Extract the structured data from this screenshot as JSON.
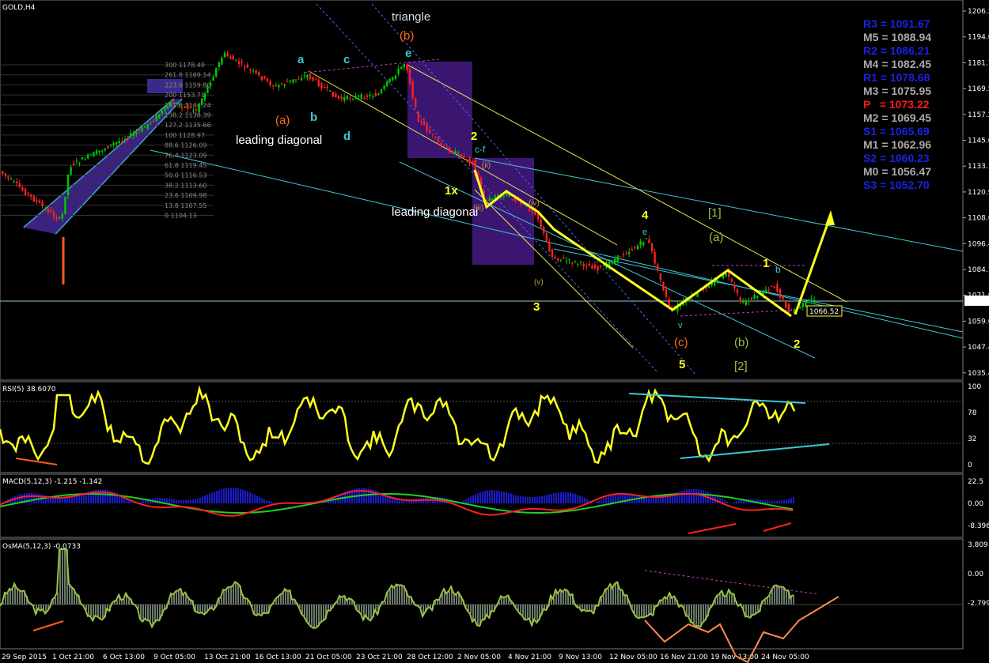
{
  "window": {
    "symbol_label": "GOLD,H4"
  },
  "price_axis": {
    "ticks": [
      "1206.25",
      "1194.00",
      "1181.75",
      "1169.50",
      "1157.25",
      "1145.00",
      "1133.15",
      "1120.90",
      "1108.65",
      "1096.40",
      "1084.15",
      "1071.90",
      "1059.65",
      "1047.40",
      "1035.40"
    ],
    "current_price": "1070.8",
    "marked_price": "1066.52"
  },
  "time_axis": {
    "ticks": [
      "29 Sep 2015",
      "1 Oct 21:00",
      "6 Oct 13:00",
      "9 Oct 05:00",
      "13 Oct 21:00",
      "16 Oct 13:00",
      "21 Oct 05:00",
      "23 Oct 21:00",
      "28 Oct 12:00",
      "2 Nov 05:00",
      "4 Nov 21:00",
      "9 Nov 13:00",
      "12 Nov 05:00",
      "16 Nov 21:00",
      "19 Nov 13:00",
      "24 Nov 05:00"
    ]
  },
  "pivots": [
    {
      "label": "R3 = 1091.67",
      "color": "#1a22e0"
    },
    {
      "label": "M5 = 1088.94",
      "color": "#a9a9a9"
    },
    {
      "label": "R2 = 1086.21",
      "color": "#1a22e0"
    },
    {
      "label": "M4 = 1082.45",
      "color": "#a9a9a9"
    },
    {
      "label": "R1 = 1078.68",
      "color": "#1a22e0"
    },
    {
      "label": "M3 = 1075.95",
      "color": "#a9a9a9"
    },
    {
      "label": "P   = 1073.22",
      "color": "#ff1a1a"
    },
    {
      "label": "M2 = 1069.45",
      "color": "#a9a9a9"
    },
    {
      "label": "S1 = 1065.69",
      "color": "#1a22e0"
    },
    {
      "label": "M1 = 1062.96",
      "color": "#a9a9a9"
    },
    {
      "label": "S2 = 1060.23",
      "color": "#1a22e0"
    },
    {
      "label": "M0 = 1056.47",
      "color": "#a9a9a9"
    },
    {
      "label": "S3 = 1052.70",
      "color": "#1a22e0"
    }
  ],
  "fib_levels": [
    "300 1178.49",
    "261.8 1169.14",
    "223.6 1159.80",
    "200 1153.71",
    "161.8 1144.24",
    "138.2 1138.39",
    "127.2 1135.66",
    "100 1128.97",
    "88.6 1126.09",
    "76.4 1123.09",
    "61.8 1119.45",
    "50.0 1116.53",
    "38.2 1113.60",
    "23.6 1109.98",
    "13.8 1107.55",
    "0 1104.13"
  ],
  "wave_labels": {
    "triangle": "triangle",
    "b_paren": "(b)",
    "e_top": "e",
    "leading1": "leading diagonal",
    "leading2": "leading diagonal",
    "a_paren": "(a)",
    "c_paren": "(c)",
    "a1": "a",
    "c1": "c",
    "b1": "b",
    "d1": "d",
    "two": "2",
    "cf": "c-f",
    "onex": "1x",
    "three": "3",
    "four": "4",
    "five": "5",
    "bracket1": "[1]",
    "a_green": "(a)",
    "b_green": "(b)",
    "bracket2": "[2]",
    "one": "1",
    "two_b": "2",
    "e_blue": "e",
    "v_blue": "v",
    "b_blue": "b",
    "iii": "(iii)",
    "iv": "(iv)",
    "v_paren": "(v)",
    "ii": "(ii)"
  },
  "rsi": {
    "label": "RSI(5) 38.6070",
    "ticks": [
      "100",
      "78",
      "32",
      "0"
    ]
  },
  "macd": {
    "label": "MACD(5,12,3) -1.215 -1.142",
    "ticks": [
      "22.5",
      "0.00",
      "-8.396"
    ]
  },
  "osma": {
    "label": "OsMA(5,12,3) -0.0733",
    "ticks": [
      "3.809",
      "0.00",
      "-2.7999"
    ]
  },
  "colors": {
    "bull": "#00c800",
    "bear": "#ff2020",
    "yellow": "#ffff20",
    "cyan": "#3fc6d6",
    "purple": "#3a1670",
    "orange": "#ff6a1a"
  }
}
